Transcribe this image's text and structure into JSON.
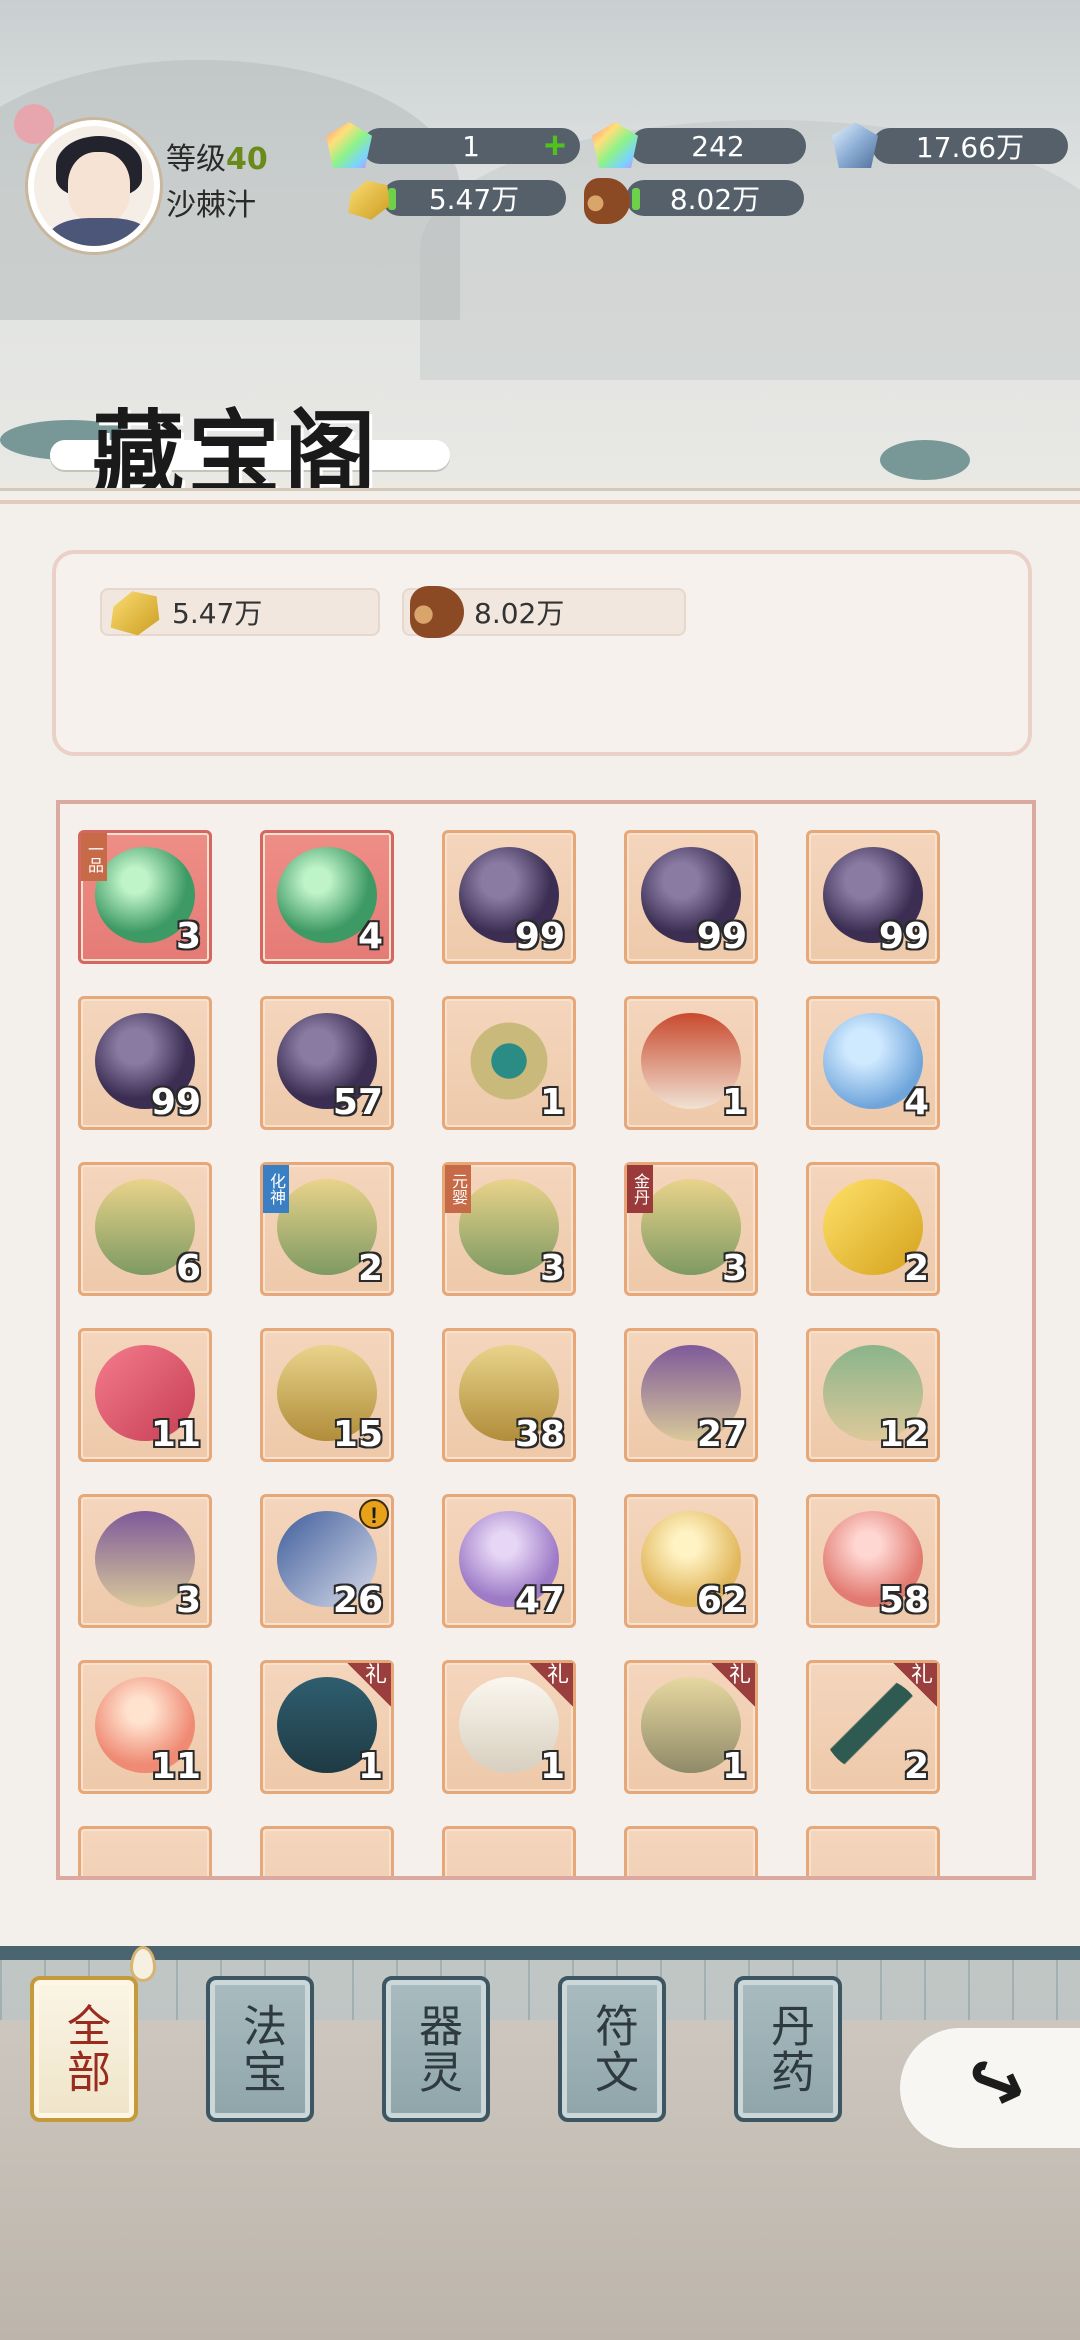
{
  "player": {
    "level_label": "等级",
    "level": "40",
    "name": "沙棘汁"
  },
  "resources_top": [
    {
      "icon": "rainbow-gem-icon",
      "value": "1",
      "has_plus": true
    },
    {
      "icon": "rainbow-gem-locked-icon",
      "value": "242"
    },
    {
      "icon": "blue-crystal-icon",
      "value": "17.66万"
    },
    {
      "icon": "gold-ore-icon",
      "value": "5.47万"
    },
    {
      "icon": "wood-log-icon",
      "value": "8.02万"
    }
  ],
  "title": "藏宝阁",
  "resources_panel": [
    {
      "icon": "gold-ore-icon",
      "value": "5.47万"
    },
    {
      "icon": "wood-log-icon",
      "value": "8.02万"
    }
  ],
  "inventory": [
    {
      "icon": "jade-orb-icon",
      "count": "3",
      "tag": "一品",
      "quality": "red"
    },
    {
      "icon": "jade-orb-flame-icon",
      "count": "4",
      "quality": "red"
    },
    {
      "icon": "dark-orb-icon",
      "count": "99"
    },
    {
      "icon": "dark-orb-icon",
      "count": "99"
    },
    {
      "icon": "dark-orb-icon",
      "count": "99"
    },
    {
      "icon": "dark-orb-icon",
      "count": "99"
    },
    {
      "icon": "dark-orb-icon",
      "count": "57"
    },
    {
      "icon": "jade-charm-icon",
      "count": "1"
    },
    {
      "icon": "red-robe-icon",
      "count": "1"
    },
    {
      "icon": "silk-cloth-icon",
      "count": "4"
    },
    {
      "icon": "golden-mask-icon",
      "count": "6"
    },
    {
      "icon": "treasure-mask-icon",
      "count": "2",
      "tag": "化神"
    },
    {
      "icon": "treasure-mask-icon",
      "count": "3",
      "tag": "元婴"
    },
    {
      "icon": "treasure-mask-icon",
      "count": "3",
      "tag": "金丹"
    },
    {
      "icon": "gold-giftbox-icon",
      "count": "2"
    },
    {
      "icon": "red-giftbox-icon",
      "count": "11"
    },
    {
      "icon": "gold-chest-icon",
      "count": "15"
    },
    {
      "icon": "orange-chest-icon",
      "count": "38"
    },
    {
      "icon": "purple-chest-icon",
      "count": "27"
    },
    {
      "icon": "green-chest-icon",
      "count": "12"
    },
    {
      "icon": "blue-chest-icon",
      "count": "3"
    },
    {
      "icon": "scroll-icon",
      "count": "26",
      "alert": "!"
    },
    {
      "icon": "purple-egg-icon",
      "count": "47"
    },
    {
      "icon": "yellow-egg-icon",
      "count": "62"
    },
    {
      "icon": "red-egg-icon",
      "count": "58"
    },
    {
      "icon": "peach-icon",
      "count": "11"
    },
    {
      "icon": "teapot-icon",
      "count": "1",
      "gift": "礼"
    },
    {
      "icon": "vase-icon",
      "count": "1",
      "gift": "礼"
    },
    {
      "icon": "armor-pants-icon",
      "count": "1",
      "gift": "礼"
    },
    {
      "icon": "sword-icon",
      "count": "2",
      "gift": "礼"
    }
  ],
  "tabs": [
    {
      "label": "全部",
      "active": true
    },
    {
      "label": "法宝"
    },
    {
      "label": "器灵"
    },
    {
      "label": "符文"
    },
    {
      "label": "丹药"
    }
  ]
}
